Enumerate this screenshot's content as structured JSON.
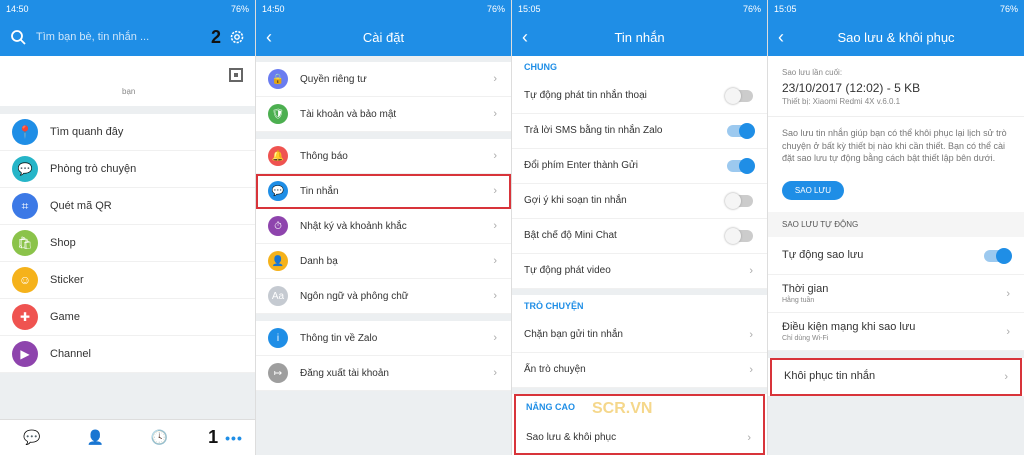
{
  "status": {
    "time1": "14:50",
    "time2": "14:50",
    "time3": "15:05",
    "time4": "15:05",
    "battery": "76%"
  },
  "screen1": {
    "search_placeholder": "Tìm bạn bè, tin nhắn ...",
    "profile_sub": "bạn",
    "items": [
      {
        "label": "Tìm quanh đây",
        "color": "#1f8ee6"
      },
      {
        "label": "Phòng trò chuyện",
        "color": "#26b5c8"
      },
      {
        "label": "Quét mã QR",
        "color": "#3c79e6"
      },
      {
        "label": "Shop",
        "color": "#8bc34a"
      },
      {
        "label": "Sticker",
        "color": "#f5b21b"
      },
      {
        "label": "Game",
        "color": "#ef5350"
      },
      {
        "label": "Channel",
        "color": "#8e44ad"
      }
    ],
    "callout_1": "1",
    "callout_2": "2"
  },
  "screen2": {
    "title": "Cài đặt",
    "items": [
      {
        "label": "Quyền riêng tư",
        "color": "#6a7cf0"
      },
      {
        "label": "Tài khoản và bảo mật",
        "color": "#4caf50"
      },
      {
        "label": "Thông báo",
        "color": "#ef5350"
      },
      {
        "label": "Tin nhắn",
        "color": "#1f8ee6"
      },
      {
        "label": "Nhật ký và khoảnh khắc",
        "color": "#8e44ad"
      },
      {
        "label": "Danh bạ",
        "color": "#f5b21b"
      },
      {
        "label": "Ngôn ngữ và phông chữ",
        "color": "#c5cad1"
      },
      {
        "label": "Thông tin về Zalo",
        "color": "#1f8ee6"
      },
      {
        "label": "Đăng xuất tài khoản",
        "color": "#9e9e9e"
      }
    ]
  },
  "screen3": {
    "title": "Tin nhắn",
    "section_chung": "CHUNG",
    "chung_items": [
      {
        "label": "Tự động phát tin nhắn thoại",
        "on": false
      },
      {
        "label": "Trả lời SMS bằng tin nhắn Zalo",
        "on": true
      },
      {
        "label": "Đổi phím Enter thành Gửi",
        "on": true
      },
      {
        "label": "Gợi ý khi soạn tin nhắn",
        "on": false
      },
      {
        "label": "Bật chế độ Mini Chat",
        "on": false
      },
      {
        "label": "Tự động phát video",
        "chevron": true
      }
    ],
    "section_tro_chuyen": "TRÒ CHUYỆN",
    "tc_items": [
      "Chặn bạn gửi tin nhắn",
      "Ẩn trò chuyện"
    ],
    "section_nang_cao": "NÂNG CAO",
    "nc_item": "Sao lưu & khôi phục",
    "watermark": "SCR.VN"
  },
  "screen4": {
    "title": "Sao lưu & khôi phục",
    "last_label": "Sao lưu lần cuối:",
    "last_date": "23/10/2017 (12:02) - 5 KB",
    "device": "Thiết bị: Xiaomi Redmi 4X v.6.0.1",
    "desc": "Sao lưu tin nhắn giúp bạn có thể khôi phục lại lịch sử trò chuyện ở bất kỳ thiết bị nào khi cần thiết. Bạn có thể cài đặt sao lưu tự động bằng cách bật thiết lập bên dưới.",
    "button": "SAO LƯU",
    "auto_header": "SAO LƯU TỰ ĐỘNG",
    "auto_toggle": "Tự động sao lưu",
    "time_label": "Thời gian",
    "time_value": "Hằng tuần",
    "network_label": "Điều kiện mạng khi sao lưu",
    "network_value": "Chỉ dùng Wi-Fi",
    "restore": "Khôi phục tin nhắn"
  }
}
